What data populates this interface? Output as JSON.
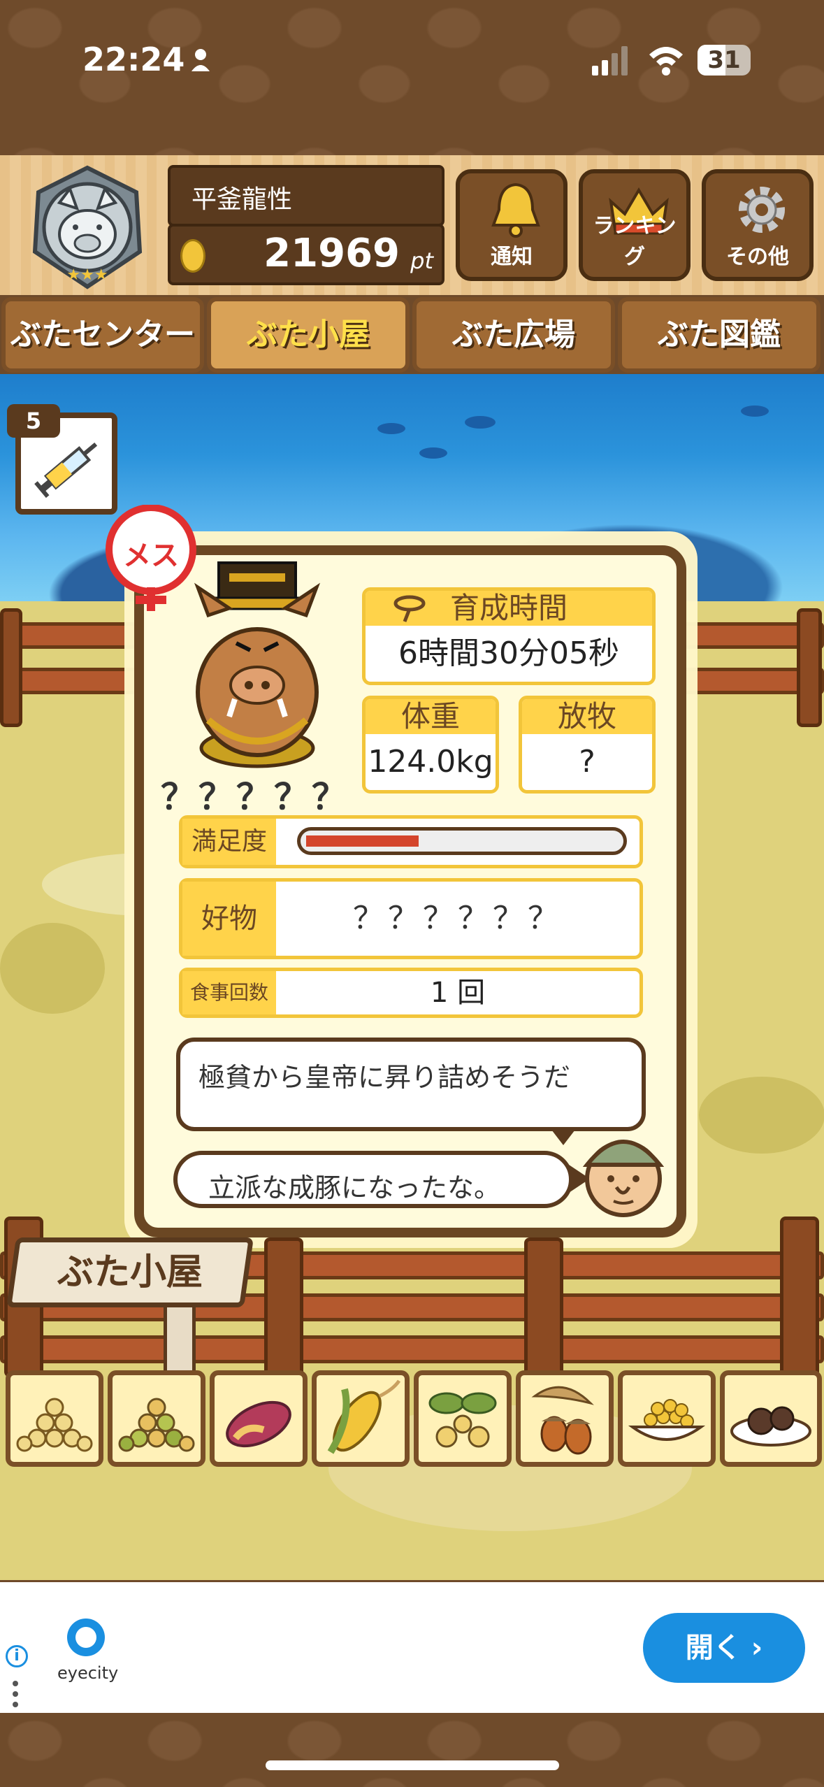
{
  "status": {
    "time": "22:24",
    "battery": "31"
  },
  "user": {
    "name": "平釜龍性",
    "points": "21969",
    "points_unit": "pt"
  },
  "header_buttons": [
    {
      "label": "通知",
      "icon": "bell-icon"
    },
    {
      "label": "ランキング",
      "icon": "crown-icon"
    },
    {
      "label": "その他",
      "icon": "gear-icon"
    }
  ],
  "tabs": [
    {
      "label": "ぶたセンター"
    },
    {
      "label": "ぶた小屋",
      "active": true
    },
    {
      "label": "ぶた広場"
    },
    {
      "label": "ぶた図鑑"
    }
  ],
  "item": {
    "count": "5",
    "icon": "syringe-icon"
  },
  "pig": {
    "gender": "メス",
    "name": "？？？？？",
    "growth_label": "育成時間",
    "growth_value": "6時間30分05秒",
    "weight_label": "体重",
    "weight_value": "124.0kg",
    "graze_label": "放牧",
    "graze_value": "?",
    "satisfaction_label": "満足度",
    "satisfaction_level": 0.36,
    "favorite_label": "好物",
    "favorite_value": "？？？？？？",
    "meals_label": "食事回数",
    "meals_value": "1 回",
    "comment": "極貧から皇帝に昇り詰めそうだ",
    "farmer_comment": "立派な成豚になったな。"
  },
  "sign": "ぶた小屋",
  "foods": [
    "soybeans-icon",
    "mixed-beans-icon",
    "sweet-potato-icon",
    "corn-icon",
    "nuts-leaf-icon",
    "acorn-icon",
    "grain-bowl-icon",
    "truffle-plate-icon"
  ],
  "ad": {
    "brand": "eyecity",
    "open_label": "開く"
  },
  "colors": {
    "accent": "#ffd34a",
    "wood": "#6b4723",
    "ad_button": "#1a8fe0"
  }
}
